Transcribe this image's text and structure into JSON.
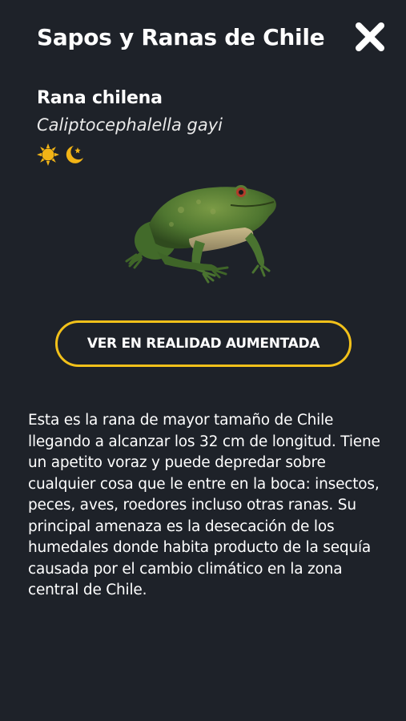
{
  "header": {
    "title": "Sapos y Ranas de Chile",
    "close_icon": "close-x-icon"
  },
  "species": {
    "common_name": "Rana chilena",
    "scientific_name": "Caliptocephalella gayi",
    "activity_icons": [
      "sun-icon",
      "moon-icon"
    ],
    "image": "frog-icon"
  },
  "ar_button": {
    "label": "VER EN REALIDAD AUMENTADA"
  },
  "description": "Esta es la rana de mayor tamaño de Chile llegando a alcanzar los 32 cm de longitud. Tiene un apetito voraz y puede depredar sobre cualquier cosa que le entre en la boca: insectos, peces, aves, roedores incluso otras ranas. Su principal amenaza es la desecación de los humedales donde habita producto de la sequía causada por el cambio climático en la zona central de Chile.",
  "colors": {
    "background": "#1e2229",
    "accent": "#f2c11a",
    "text": "#ffffff"
  }
}
